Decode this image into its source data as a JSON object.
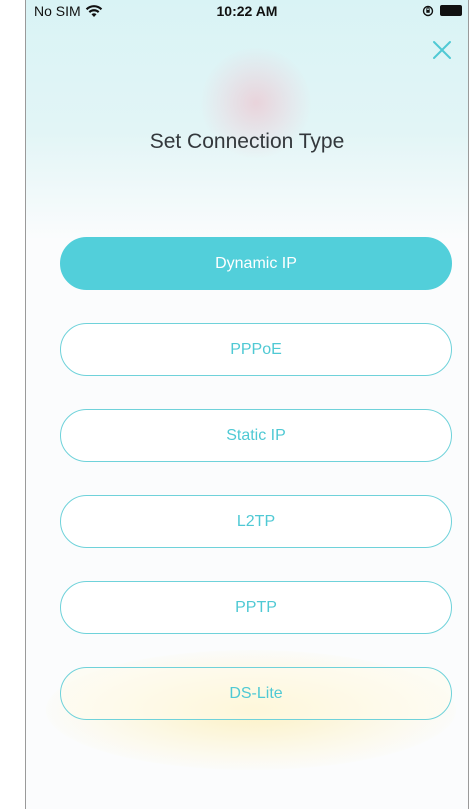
{
  "status_bar": {
    "carrier": "No SIM",
    "time": "10:22 AM",
    "icons": [
      "wifi-icon",
      "rotation-lock-icon",
      "battery-icon"
    ]
  },
  "header": {
    "title": "Set Connection Type",
    "close_icon": "close-icon"
  },
  "options": [
    {
      "label": "Dynamic IP",
      "selected": true
    },
    {
      "label": "PPPoE",
      "selected": false
    },
    {
      "label": "Static IP",
      "selected": false
    },
    {
      "label": "L2TP",
      "selected": false
    },
    {
      "label": "PPTP",
      "selected": false
    },
    {
      "label": "DS-Lite",
      "selected": false
    }
  ],
  "colors": {
    "accent": "#52cfda",
    "button_text": "#4fc9d4",
    "title": "#33383c",
    "top_tint": "#d9f3f5"
  }
}
